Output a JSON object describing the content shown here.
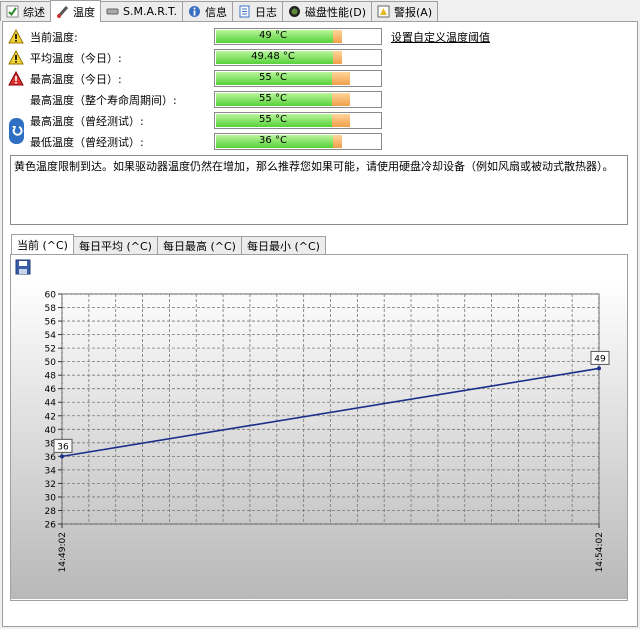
{
  "tabs": [
    {
      "label": "综述",
      "icon": "check-icon"
    },
    {
      "label": "温度",
      "icon": "thermometer-icon"
    },
    {
      "label": "S.M.A.R.T.",
      "icon": "disk-icon"
    },
    {
      "label": "信息",
      "icon": "info-icon"
    },
    {
      "label": "日志",
      "icon": "log-icon"
    },
    {
      "label": "磁盘性能(D)",
      "icon": "gauge-icon"
    },
    {
      "label": "警报(A)",
      "icon": "alert-icon"
    }
  ],
  "rows": [
    {
      "label": "当前温度:",
      "value": "49 °C",
      "icon": "warning-icon",
      "level": 0.77
    },
    {
      "label": "平均温度（今日）:",
      "value": "49.48 °C",
      "icon": "warning-icon",
      "level": 0.77
    },
    {
      "label": "最高温度（今日）:",
      "value": "55 °C",
      "icon": "error-icon",
      "level": 0.82
    },
    {
      "label": "最高温度（整个寿命周期间）:",
      "value": "55 °C",
      "icon": "",
      "level": 0.82
    },
    {
      "label": "最高温度（曾经测试）:",
      "value": "55 °C",
      "icon": "",
      "level": 0.82
    },
    {
      "label": "最低温度（曾经测试）:",
      "value": "36 °C",
      "icon": "",
      "level": 0.77
    }
  ],
  "custom_link": "设置自定义温度阈值",
  "info_text": "黄色温度限制到达。如果驱动器温度仍然在增加，那么推荐您如果可能，请使用硬盘冷却设备（例如风扇或被动式散热器）。",
  "chart_tabs": [
    "当前 (^C)",
    "每日平均 (^C)",
    "每日最高 (^C)",
    "每日最小 (^C)"
  ],
  "colors": {
    "line": "#1a2f8a",
    "bar_green": "#56d13a",
    "bar_orange": "#f0a04a"
  },
  "chart_data": {
    "type": "line",
    "x": [
      "14:49:02",
      "14:54:02"
    ],
    "series": [
      {
        "values": [
          36,
          49
        ]
      }
    ],
    "ylim": [
      26,
      60
    ],
    "yticks": [
      26,
      28,
      30,
      32,
      34,
      36,
      38,
      40,
      42,
      44,
      46,
      48,
      50,
      52,
      54,
      56,
      58,
      60
    ],
    "data_labels": [
      "36",
      "49"
    ],
    "grid": true
  }
}
